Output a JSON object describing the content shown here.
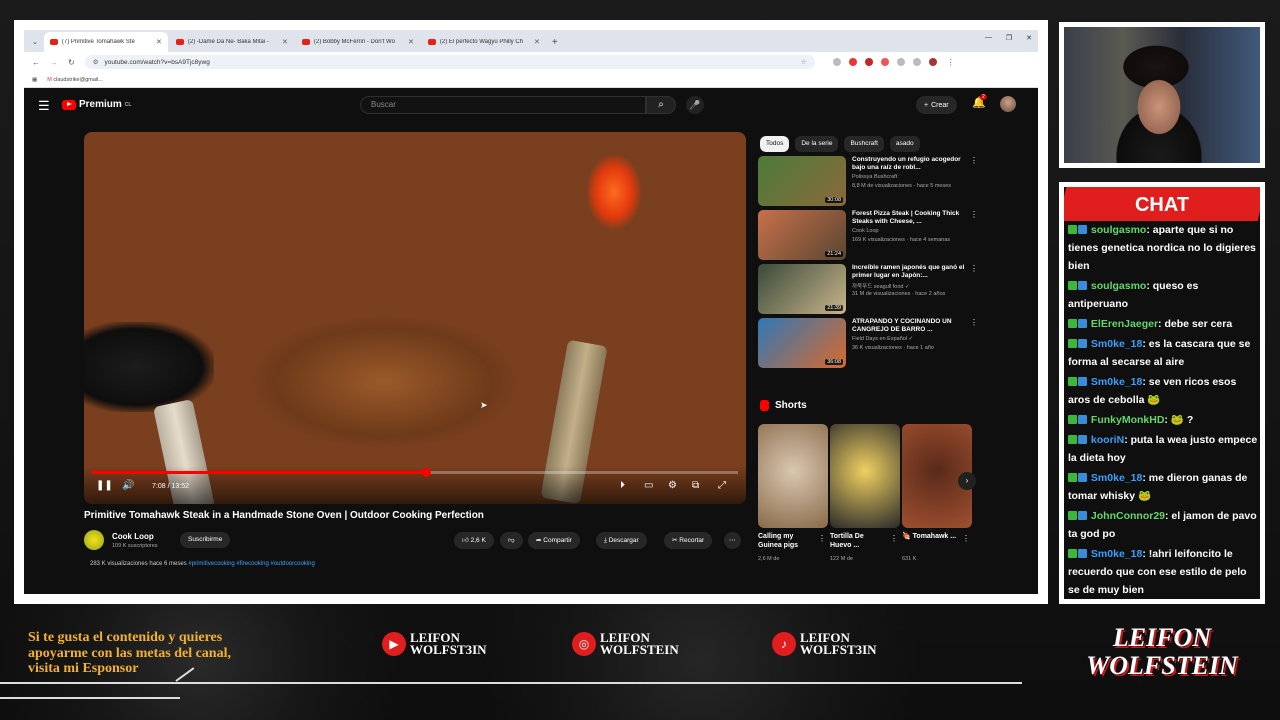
{
  "browser": {
    "tabs": [
      {
        "title": "(7) Primitive Tomahawk Ste",
        "active": true
      },
      {
        "title": "(2) -Dame Da Ne- Baka Mitai -",
        "active": false
      },
      {
        "title": "(2) Bobby McFerrin - Don't Wo",
        "active": false
      },
      {
        "title": "(2) El perfecto Wagyu Philly Ch",
        "active": false
      }
    ],
    "url": "youtube.com/watch?v=bsA9Tjc8ywg",
    "bookmark": "claudstrike@gmail..."
  },
  "youtube": {
    "logo": "Premium",
    "logo_sup": "CL",
    "search_placeholder": "Buscar",
    "create_label": "Crear",
    "notifications_count": "2",
    "video": {
      "progress": 0.517,
      "time": "7:08 / 13:52",
      "title": "Primitive Tomahawk Steak in a Handmade Stone Oven | Outdoor Cooking Perfection"
    },
    "channel": {
      "name": "Cook Loop",
      "subs": "109 K suscriptores",
      "subscribe": "Suscribirme"
    },
    "actions": {
      "likes": "2,6 K",
      "share": "Compartir",
      "download": "Descargar",
      "clip": "Recortar"
    },
    "description": {
      "views": "283 K visualizaciones  hace 6 meses",
      "tags": "#primitivecooking #firecooking #outdoorcooking"
    },
    "chips": [
      "Todos",
      "De la serie",
      "Bushcraft",
      "asado"
    ],
    "recommendations": [
      {
        "title": "Construyendo un refugio acogedor bajo una raíz de robl...",
        "channel": "Polissya Bushcraft",
        "meta": "8,8 M de visualizaciones · hace 5 meses",
        "duration": "30:08",
        "colors": "#4d7a3a,#8a6a3a"
      },
      {
        "title": "Forest Pizza Steak | Cooking Thick Steaks with Cheese, ...",
        "channel": "Cook Loop",
        "meta": "169 K visualizaciones · hace 4 semanas",
        "duration": "21:24",
        "colors": "#c8704a,#5a4632"
      },
      {
        "title": "Increíble ramen japonés que ganó el primer lugar en Japón:...",
        "channel": "까묵푸드 seagull food ✓",
        "meta": "31 M de visualizaciones · hace 2 años",
        "duration": "21:39",
        "colors": "#3a4a3a,#c8b48a"
      },
      {
        "title": "ATRAPANDO Y COCINANDO UN CANGREJO DE BARRO ...",
        "channel": "Field Days en Español ✓",
        "meta": "36 K visualizaciones · hace 1 año",
        "duration": "36:08",
        "colors": "#2f78b8,#d86a2a"
      }
    ],
    "shorts_label": "Shorts",
    "shorts": [
      {
        "title": "Calling my Guinea pigs",
        "views": "2,6 M de",
        "colors": "#d8c8b0,#8a6a4a"
      },
      {
        "title": "Tortilla De Huevo ...",
        "views": "122 M de",
        "colors": "#f0d060,#2a2a2a"
      },
      {
        "title": "🍖 Tomahawk ...",
        "views": "631 K",
        "colors": "#5a2a1a,#a05030"
      }
    ]
  },
  "chat": {
    "title": "CHAT",
    "messages": [
      {
        "user": "soulgasmo",
        "text": ": aparte que si no tienes genetica nordica no lo digieres bien",
        "style": "u1"
      },
      {
        "user": "soulgasmo",
        "text": ": queso es antiperuano",
        "style": "u1"
      },
      {
        "user": "ElErenJaeger",
        "text": ": debe ser cera",
        "style": "u1"
      },
      {
        "user": "Sm0ke_18",
        "text": ": es la cascara que se forma al secarse al aire",
        "style": "u2"
      },
      {
        "user": "Sm0ke_18",
        "text": ": se ven ricos esos aros de cebolla 🐸",
        "style": "u2"
      },
      {
        "user": "FunkyMonkHD",
        "text": ": 🐸 ?",
        "style": "u1"
      },
      {
        "user": "kooriN",
        "text": ": puta la wea justo empece la dieta hoy",
        "style": "u2"
      },
      {
        "user": "Sm0ke_18",
        "text": ": me dieron ganas de tomar whisky 🐸",
        "style": "u2"
      },
      {
        "user": "JohnConnor29",
        "text": ": el jamon de pavo ta god po",
        "style": "u1"
      },
      {
        "user": "Sm0ke_18",
        "text": ": !ahri leifoncito le recuerdo que con ese estilo de pelo se de muy bien",
        "style": "u2"
      }
    ]
  },
  "overlay": {
    "sponsor_line1": "Si te gusta el contenido y quieres",
    "sponsor_line2": "apoyarme con las metas del canal,",
    "sponsor_line3": "visita mi Esponsor",
    "socials": [
      {
        "icon": "youtube-icon",
        "glyph": "▶",
        "line1": "LEIFON",
        "line2": "WOLFST3IN"
      },
      {
        "icon": "instagram-icon",
        "glyph": "◎",
        "line1": "LEIFON",
        "line2": "WOLFSTEIN"
      },
      {
        "icon": "tiktok-icon",
        "glyph": "♪",
        "line1": "LEIFON",
        "line2": "WOLFST3IN"
      }
    ],
    "brand_line1": "LEIFON",
    "brand_line2": "WOLFSTEIN"
  }
}
